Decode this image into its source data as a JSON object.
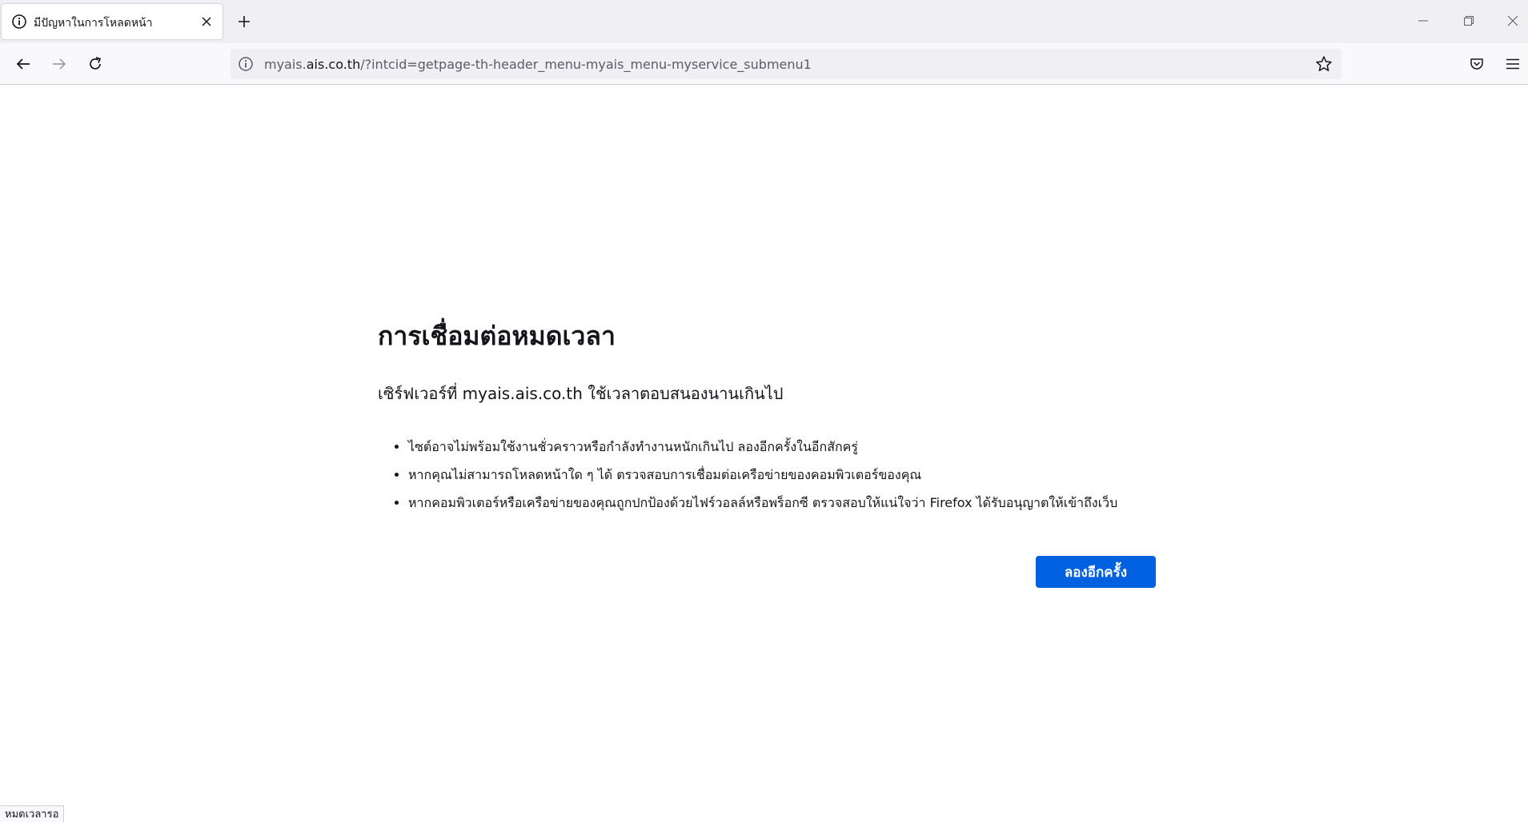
{
  "browser": {
    "tab": {
      "title": "มีปัญหาในการโหลดหน้า",
      "icon": "info-icon",
      "close_icon": "close-icon"
    },
    "new_tab_icon": "plus-icon",
    "window_controls": [
      "minimize-icon",
      "restore-icon",
      "close-icon"
    ],
    "nav": {
      "back_icon": "back-arrow-icon",
      "forward_icon": "forward-arrow-icon",
      "reload_icon": "reload-icon"
    },
    "urlbar": {
      "prefix": "myais.",
      "domain": "ais.co.th",
      "path": "/?intcid=getpage-th-header_menu-myais_menu-myservice_submenu1",
      "info_icon": "info-icon",
      "bookmark_icon": "star-icon"
    },
    "toolbar_right": [
      "pocket-icon",
      "hamburger-menu-icon"
    ]
  },
  "error_page": {
    "title": "การเชื่อมต่อหมดเวลา",
    "description": "เซิร์ฟเวอร์ที่ myais.ais.co.th ใช้เวลาตอบสนองนานเกินไป",
    "suggestions": [
      "ไซต์อาจไม่พร้อมใช้งานชั่วคราวหรือกำลังทำงานหนักเกินไป ลองอีกครั้งในอีกสักครู่",
      "หากคุณไม่สามารถโหลดหน้าใด ๆ ได้ ตรวจสอบการเชื่อมต่อเครือข่ายของคอมพิวเตอร์ของคุณ",
      "หากคอมพิวเตอร์หรือเครือข่ายของคุณถูกปกป้องด้วยไฟร์วอลล์หรือพร็อกซี ตรวจสอบให้แน่ใจว่า Firefox ได้รับอนุญาตให้เข้าถึงเว็บ"
    ],
    "retry_label": "ลองอีกครั้ง",
    "accent_color": "#0061e0"
  },
  "status_bar": {
    "text": "หมดเวลารอ"
  }
}
